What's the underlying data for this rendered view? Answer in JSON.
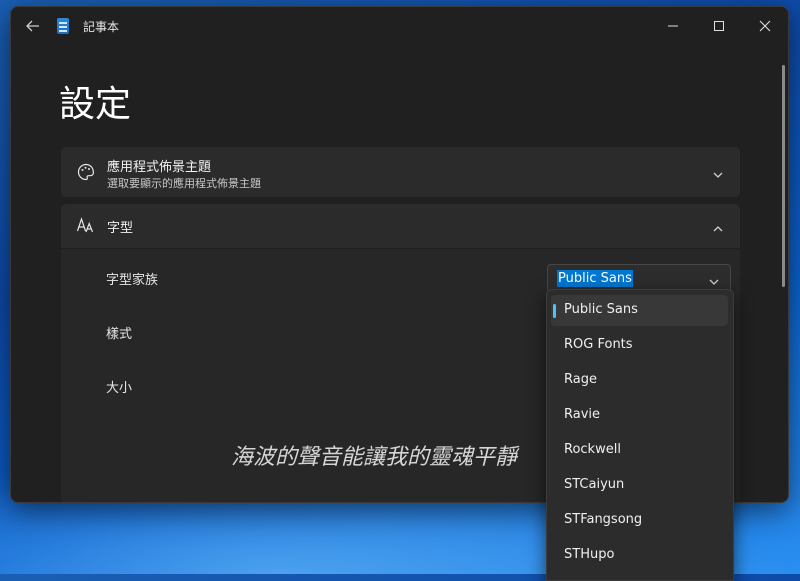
{
  "window": {
    "title": "記事本"
  },
  "page": {
    "title": "設定"
  },
  "theme_card": {
    "title": "應用程式佈景主題",
    "subtitle": "選取要顯示的應用程式佈景主題"
  },
  "font_card": {
    "title": "字型",
    "family_label": "字型家族",
    "style_label": "樣式",
    "size_label": "大小",
    "family_value": "Public Sans",
    "preview_text": "海波的聲音能讓我的靈魂平靜"
  },
  "font_dropdown": {
    "options": [
      "Public Sans",
      "ROG Fonts",
      "Rage",
      "Ravie",
      "Rockwell",
      "STCaiyun",
      "STFangsong",
      "STHupo"
    ],
    "selected": "Public Sans"
  },
  "colors": {
    "accent": "#4cc2ff",
    "selection": "#0078d4",
    "window_bg": "#202020"
  }
}
